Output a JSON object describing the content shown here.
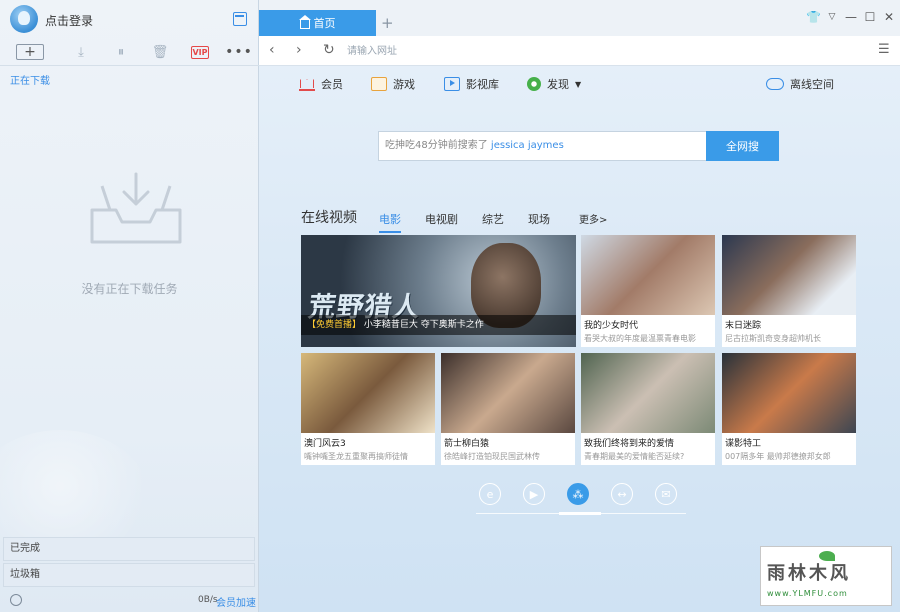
{
  "left_panel": {
    "login_text": "点击登录",
    "downloading_label": "正在下载",
    "empty_text": "没有正在下载任务",
    "completed_label": "已完成",
    "trash_label": "垃圾箱",
    "speed": "0B/s",
    "vip_accel": "会员加速",
    "toolbar": {
      "new_task_glyph": "+",
      "vip_glyph": "VIP",
      "more_glyph": "•••"
    }
  },
  "tabs": {
    "home_label": "首页",
    "add_glyph": "+"
  },
  "address_bar": {
    "placeholder": "请输入网址"
  },
  "nav_links": {
    "member": "会员",
    "games": "游戏",
    "video_library": "影视库",
    "discover": "发现",
    "offline_space": "离线空间"
  },
  "search": {
    "history_prefix": "吃抻吃48分钟前搜索了",
    "history_term": "jessica jaymes",
    "button_label": "全网搜"
  },
  "video_section": {
    "title": "在线视频",
    "categories": {
      "movies": "电影",
      "tv": "电视剧",
      "variety": "综艺",
      "live": "现场",
      "more": "更多>"
    },
    "featured": {
      "logo_text": "荒野猎人",
      "caption_tag": "【免费首播】",
      "caption_text": "小李糙昔巨大 夺下奥斯卡之作"
    },
    "cards": [
      {
        "title": "我的少女时代",
        "subtitle": "看哭大叔的年度最温票青春电影"
      },
      {
        "title": "末日迷踪",
        "subtitle": "尼古拉斯凯奇变身超帅机长"
      },
      {
        "title": "澳门风云3",
        "subtitle": "嘴钟嘴圣龙五重聚再搞师徒情"
      },
      {
        "title": "箭士柳白猿",
        "subtitle": "徐皓峰打造铂现民国武林传"
      },
      {
        "title": "致我们终将到来的爱情",
        "subtitle": "青春期最美的爱情能否延续?"
      },
      {
        "title": "谍影特工",
        "subtitle": "007隔多年 最帅邦德撩邦女郎"
      }
    ]
  },
  "watermark": {
    "title": "雨林木风",
    "url": "www.YLMFU.com"
  },
  "colors": {
    "accent": "#3a9be8",
    "link_blue": "#3a8ee6",
    "vip_red": "#e54848"
  }
}
